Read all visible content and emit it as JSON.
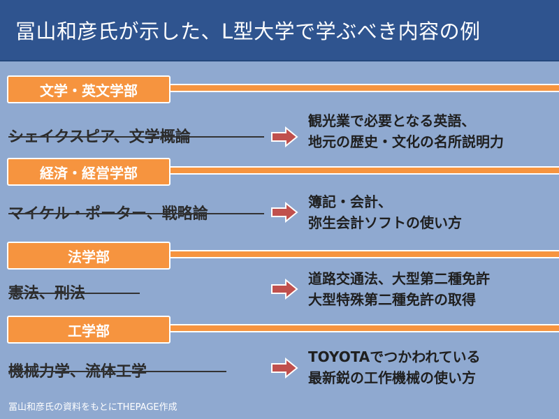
{
  "title": "冨山和彦氏が示した、L型大学で学ぶべき内容の例",
  "sections": [
    {
      "header": "文学・英文学部",
      "struck": "シェイクスピア、文学概論",
      "result": [
        "観光業で必要となる英語、",
        "地元の歴史・文化の名所説明力"
      ]
    },
    {
      "header": "経済・経営学部",
      "struck": "マイケル・ポーター、戦略論",
      "result": [
        "簿記・会計、",
        "弥生会計ソフトの使い方"
      ]
    },
    {
      "header": "法学部",
      "struck": "憲法、刑法",
      "result": [
        "道路交通法、大型第二種免許",
        "大型特殊第二種免許の取得"
      ]
    },
    {
      "header": "工学部",
      "struck": "機械力学、流体工学",
      "result": [
        "TOYOTAでつかわれている",
        "最新鋭の工作機械の使い方"
      ]
    }
  ],
  "footer": "冨山和彦氏の資料をもとにTHEPAGE作成",
  "colors": {
    "title_bg": "#2f548f",
    "background": "#8fa9d0",
    "accent_orange": "#f6943f",
    "arrow_red": "#c0504d"
  }
}
